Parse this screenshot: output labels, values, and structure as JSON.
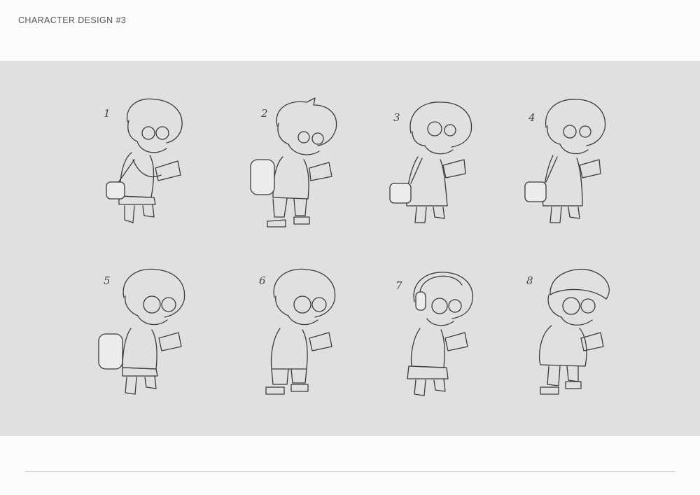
{
  "page": {
    "title": "CHARACTER DESIGN  #3"
  },
  "sketches": [
    {
      "number": "1",
      "variant": "skirt-satchel"
    },
    {
      "number": "2",
      "variant": "backpack-spiky-hair"
    },
    {
      "number": "3",
      "variant": "bob-dress-satchel"
    },
    {
      "number": "4",
      "variant": "dress-satchel"
    },
    {
      "number": "5",
      "variant": "backpack-skirt"
    },
    {
      "number": "6",
      "variant": "shorts"
    },
    {
      "number": "7",
      "variant": "headphones-skirt"
    },
    {
      "number": "8",
      "variant": "beanie-sweater"
    }
  ],
  "colors": {
    "background": "#fbfbfb",
    "sheet": "#e0e0e0",
    "line": "#3a3a3a"
  }
}
